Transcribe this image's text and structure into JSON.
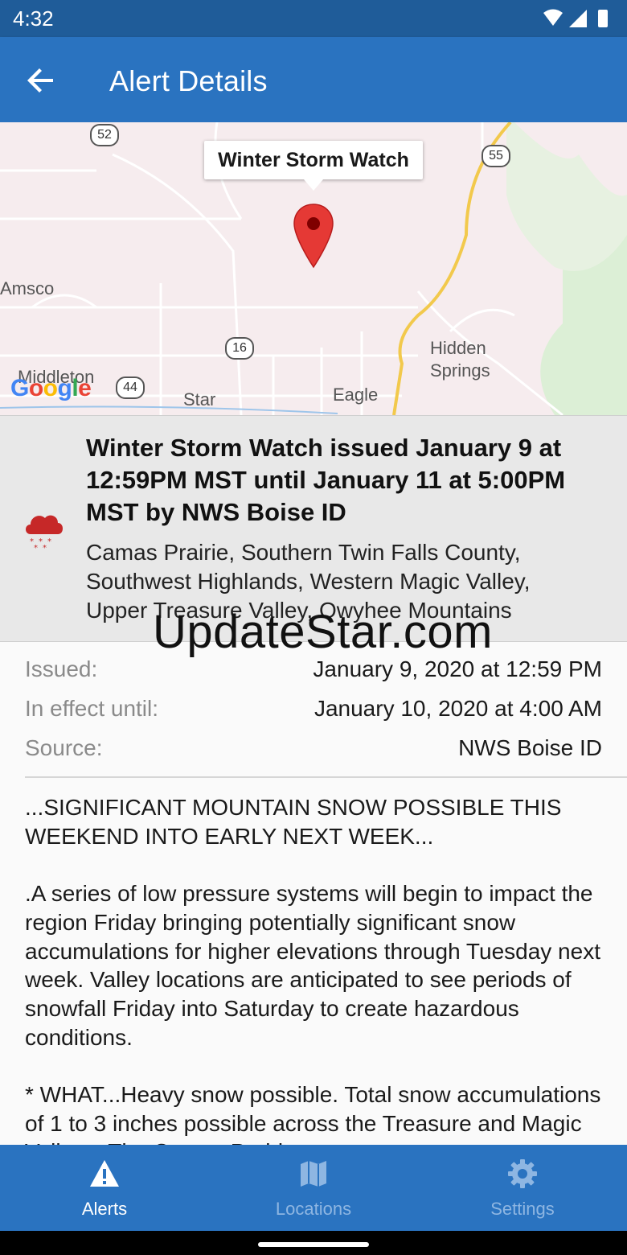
{
  "status_bar": {
    "time": "4:32"
  },
  "app_bar": {
    "title": "Alert Details",
    "back_icon": "arrow-back-icon"
  },
  "map": {
    "callout": "Winter Storm Watch",
    "labels": {
      "amsco": "Amsco",
      "middleton": "Middleton",
      "star": "Star",
      "eagle": "Eagle",
      "hidden_springs": "Hidden\nSprings"
    },
    "shields": {
      "r52": "52",
      "r55": "55",
      "r16": "16",
      "r44": "44"
    },
    "attribution": "Google"
  },
  "summary": {
    "icon": "snow-cloud-icon",
    "title": "Winter Storm Watch issued January 9 at 12:59PM MST until January 11 at 5:00PM MST by NWS Boise ID",
    "areas": "Camas Prairie, Southern Twin  Falls County,\nSouthwest Highlands, Western Magic Valley,\nUpper Treasure Valley, Owyhee Mountains"
  },
  "watermark": "UpdateStar.com",
  "details": {
    "issued_label": "Issued:",
    "issued_value": "January 9, 2020 at 12:59 PM",
    "effect_label": "In effect until:",
    "effect_value": "January 10, 2020 at 4:00 AM",
    "source_label": "Source:",
    "source_value": "NWS Boise ID"
  },
  "body": "...SIGNIFICANT MOUNTAIN SNOW POSSIBLE THIS WEEKEND INTO EARLY NEXT WEEK...\n\n.A series of low pressure systems will begin to impact the region Friday bringing potentially significant snow accumulations for higher elevations through Tuesday next week. Valley locations are anticipated to see periods of snowfall Friday into Saturday to create hazardous conditions.\n\n* WHAT...Heavy snow possible. Total snow accumulations of 1 to 3 inches possible across the Treasure and Magic Valleys. The Camas Prairie",
  "bottom_nav": {
    "alerts": {
      "label": "Alerts",
      "icon": "warning-triangle-icon"
    },
    "locations": {
      "label": "Locations",
      "icon": "map-icon"
    },
    "settings": {
      "label": "Settings",
      "icon": "gear-icon"
    }
  },
  "colors": {
    "app_bar": "#2a73c0",
    "status_bar": "#1f5c99",
    "pin": "#e53935",
    "alert_icon": "#c62828"
  }
}
